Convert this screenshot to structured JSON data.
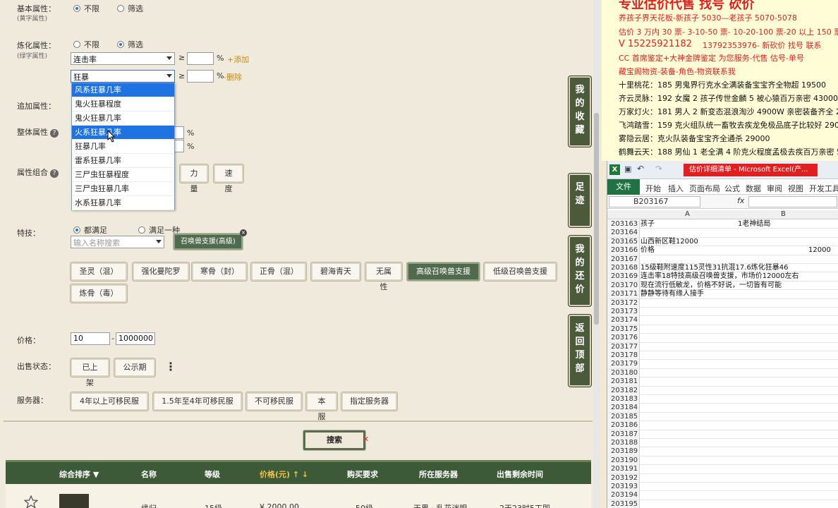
{
  "filters": {
    "basic": {
      "label": "基本属性：",
      "sub": "(黄字属性)",
      "opt1": "不限",
      "opt2": "筛选"
    },
    "refine": {
      "label": "炼化属性：",
      "sub": "(绿字属性)",
      "opt1": "不限",
      "opt2": "筛选",
      "row1_select": "连击率",
      "row1_op": "≥",
      "row1_pct": "%",
      "row1_link": "+添加",
      "row2_select": "狂暴",
      "row2_op": "≥",
      "row2_pct": "%",
      "row2_link": "-删除"
    },
    "dropdown_options": [
      "风系狂暴几率",
      "鬼火狂暴程度",
      "鬼火狂暴几率",
      "火系狂暴几率",
      "狂暴几率",
      "雷系狂暴几率",
      "三尸虫狂暴程度",
      "三尸虫狂暴几率",
      "水系狂暴几率"
    ],
    "extra": {
      "label": "追加属性："
    },
    "overall": {
      "label": "整体属性",
      "pct1": "%",
      "pct2": "%"
    },
    "combo": {
      "label": "属性组合",
      "btn1": "力量",
      "btn2": "速度"
    },
    "skill": {
      "label": "特技：",
      "opt1": "都满足",
      "opt2": "满足一种",
      "search_placeholder": "输入名称搜索",
      "tag": "召唤兽支援(高级)",
      "buttons": [
        "圣灵（混）",
        "强化曼陀罗",
        "寒骨（封）",
        "正骨（混）",
        "碧海青天",
        "无属性",
        "高级召唤兽支援",
        "低级召唤兽支援",
        "炼骨（毒）"
      ]
    },
    "price": {
      "label": "价格：",
      "min": "10",
      "dash": "-",
      "max": "1000000"
    },
    "sale_status": {
      "label": "出售状态：",
      "btn1": "已上架",
      "btn2": "公示期",
      "more": "⋮"
    },
    "server": {
      "label": "服务器：",
      "buttons": [
        "4年以上可移民服",
        "1.5年至4年可移民服",
        "不可移民服",
        "本服",
        "指定服务器"
      ]
    },
    "search_button": "搜索"
  },
  "side_tabs": [
    {
      "label": "我的收藏"
    },
    {
      "label": "足迹"
    },
    {
      "label": "我的还价"
    },
    {
      "label": "返回顶部"
    }
  ],
  "results_header": {
    "cols": [
      "综合排序 ▼",
      "名称",
      "等级",
      "价格(元) ↑ ↓",
      "购买要求",
      "所在服务器",
      "出售剩余时间"
    ]
  },
  "results_row": {
    "name": "缘归",
    "level": "15级",
    "price": "¥ 2000.00",
    "req": "50级",
    "server": "天界 · 乱花迷眼",
    "time": "2天23时5ㄒ即"
  },
  "ad_text": {
    "line0": "专业估价代售 找号 砍价",
    "line1": "养孩子界天花板-新孩子 5030—老孩子 5070-5078",
    "line2": "估价 3 万内 30 票- 3-10-50 票- 10-20-100 票-20 以上 150 票-1 票 1",
    "line3": "V 15225921182",
    "line3b": "13792353976- 新砍价 找号 联系",
    "line4": "CC 首席鉴定+大神金牌鉴定 为您服务-代售 估号-单号",
    "line5": "藏宝阁物资-装备-角色-物资联系我",
    "entries": [
      "十里桃花：185 男鬼界行克水全满装备宝宝齐全物超 19500",
      "齐云灵脉：192 女魔 2 孩子传世金麟 5 被心猿百万亲密 43000",
      "万家灯火：181 男人 2 新变态混浪淘沙 4900W 亲密装备齐全 2300",
      "飞鸿踏雪：159 克火组队统一畜牧去疾龙免极品底子比较好 29000",
      "雾隐云居：克火队装备宝宝齐全通杀 29000",
      "鹤舞云天：188 男仙 1 老全满 4 阶克火程度孟极去疾百万亲密 540"
    ]
  },
  "excel": {
    "title": "估价详细清单 - Microsoft Excel(产...",
    "tabs": [
      "文件",
      "开始",
      "插入",
      "页面布局",
      "公式",
      "数据",
      "审阅",
      "视图",
      "开发工具"
    ],
    "name_box": "B203167",
    "fx": "fx",
    "col_a": "A",
    "col_b": "B",
    "rows": [
      {
        "n": "203163",
        "a": "孩子",
        "b": "1老神结局"
      },
      {
        "n": "203164",
        "a": "",
        "b": ""
      },
      {
        "n": "203165",
        "a": "山西新区鞋12000",
        "b": ""
      },
      {
        "n": "203166",
        "a": "价格",
        "b": "12000"
      },
      {
        "n": "203167",
        "a": "",
        "b": ""
      },
      {
        "n": "203168",
        "a": "15级鞋附速度115灵性31抗混17.6炼化狂暴46",
        "b": ""
      },
      {
        "n": "203169",
        "a": "连击率18特技高级召唤兽支援，市场价12000左右",
        "b": ""
      },
      {
        "n": "203170",
        "a": "现在流行低敏龙，价格不好说，一切皆有可能",
        "b": ""
      },
      {
        "n": "203171",
        "a": "静静等待有缘人接手",
        "b": ""
      },
      {
        "n": "203172",
        "a": "",
        "b": ""
      },
      {
        "n": "203173",
        "a": "",
        "b": ""
      },
      {
        "n": "203174",
        "a": "",
        "b": ""
      },
      {
        "n": "203175",
        "a": "",
        "b": ""
      },
      {
        "n": "203176",
        "a": "",
        "b": ""
      },
      {
        "n": "203177",
        "a": "",
        "b": ""
      },
      {
        "n": "203178",
        "a": "",
        "b": ""
      },
      {
        "n": "203179",
        "a": "",
        "b": ""
      },
      {
        "n": "203180",
        "a": "",
        "b": ""
      },
      {
        "n": "203181",
        "a": "",
        "b": ""
      },
      {
        "n": "203182",
        "a": "",
        "b": ""
      },
      {
        "n": "203183",
        "a": "",
        "b": ""
      },
      {
        "n": "203184",
        "a": "",
        "b": ""
      },
      {
        "n": "203185",
        "a": "",
        "b": ""
      },
      {
        "n": "203186",
        "a": "",
        "b": ""
      },
      {
        "n": "203187",
        "a": "",
        "b": ""
      },
      {
        "n": "203188",
        "a": "",
        "b": ""
      },
      {
        "n": "203189",
        "a": "",
        "b": ""
      },
      {
        "n": "203190",
        "a": "",
        "b": ""
      },
      {
        "n": "203191",
        "a": "",
        "b": ""
      },
      {
        "n": "203192",
        "a": "",
        "b": ""
      },
      {
        "n": "203193",
        "a": "",
        "b": ""
      },
      {
        "n": "203194",
        "a": "",
        "b": ""
      },
      {
        "n": "203195",
        "a": "",
        "b": ""
      }
    ]
  }
}
